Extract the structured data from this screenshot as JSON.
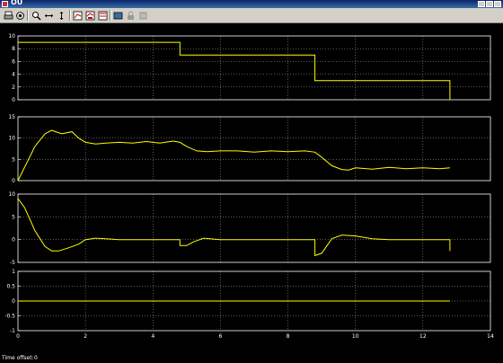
{
  "window": {
    "title": "OU"
  },
  "toolbar": {
    "buttons": [
      {
        "name": "print-icon"
      },
      {
        "name": "parameters-icon"
      },
      {
        "name": "zoom-icon"
      },
      {
        "name": "zoom-x-icon"
      },
      {
        "name": "zoom-y-icon"
      },
      {
        "name": "autoscale-icon"
      },
      {
        "name": "save-axes-icon"
      },
      {
        "name": "restore-axes-icon"
      },
      {
        "name": "floating-scope-icon"
      },
      {
        "name": "lock-axes-icon"
      },
      {
        "name": "signal-selection-icon"
      }
    ]
  },
  "status": {
    "time_offset_label": "Time offset:",
    "time_offset_value": "0"
  },
  "colors": {
    "trace": "#ffff00",
    "background": "#000000",
    "axes_bg": "#000000",
    "frame": "#ffffff",
    "grid": "#ffffff"
  },
  "chart_data": [
    {
      "type": "line",
      "title": "",
      "xlabel": "",
      "ylabel": "",
      "xlim": [
        0,
        14
      ],
      "ylim": [
        0,
        10
      ],
      "yticks": [
        "0",
        "2",
        "4",
        "6",
        "8",
        "10"
      ],
      "xticks": [],
      "grid": true,
      "series": [
        {
          "x": [
            0,
            4.8,
            4.8,
            8.8,
            8.8,
            12.8,
            12.8
          ],
          "y": [
            9,
            9,
            7,
            7,
            3,
            3,
            0
          ]
        }
      ]
    },
    {
      "type": "line",
      "title": "",
      "xlabel": "",
      "ylabel": "",
      "xlim": [
        0,
        14
      ],
      "ylim": [
        0,
        15
      ],
      "yticks": [
        "0",
        "5",
        "10",
        "15"
      ],
      "xticks": [],
      "grid": true,
      "series": [
        {
          "x": [
            0,
            0.25,
            0.5,
            0.8,
            1.0,
            1.3,
            1.6,
            1.8,
            2.0,
            2.3,
            2.6,
            3.0,
            3.4,
            3.8,
            4.2,
            4.6,
            4.8,
            5.0,
            5.3,
            5.6,
            6.0,
            6.5,
            7.0,
            7.5,
            8.0,
            8.5,
            8.8,
            9.0,
            9.3,
            9.6,
            9.8,
            10.0,
            10.5,
            11.0,
            11.5,
            12.0,
            12.5,
            12.8
          ],
          "y": [
            0,
            4,
            8,
            11,
            11.8,
            11,
            11.5,
            10,
            9,
            8.6,
            8.8,
            9,
            8.8,
            9.2,
            8.8,
            9.3,
            9,
            8,
            7,
            6.8,
            7,
            7,
            6.7,
            7,
            6.8,
            7,
            6.7,
            5.5,
            3.5,
            2.6,
            2.5,
            3,
            2.7,
            3.1,
            2.8,
            3,
            2.8,
            3
          ]
        }
      ]
    },
    {
      "type": "line",
      "title": "",
      "xlabel": "",
      "ylabel": "",
      "xlim": [
        0,
        14
      ],
      "ylim": [
        -5,
        10
      ],
      "yticks": [
        "-5",
        "0",
        "5",
        "10"
      ],
      "xticks": [],
      "grid": true,
      "series": [
        {
          "x": [
            0,
            0.2,
            0.5,
            0.8,
            1.0,
            1.2,
            1.5,
            1.8,
            2.0,
            2.3,
            2.6,
            3.0,
            4.0,
            4.8,
            4.8,
            5.0,
            5.2,
            5.5,
            6.0,
            7.0,
            8.0,
            8.8,
            8.8,
            9.0,
            9.3,
            9.6,
            10.0,
            10.5,
            11.0,
            12.0,
            12.8,
            12.8
          ],
          "y": [
            9,
            7,
            2,
            -1.5,
            -2.5,
            -2.5,
            -1.8,
            -1,
            0,
            0.3,
            0.2,
            0,
            0,
            0,
            -1.3,
            -1.3,
            -0.5,
            0.3,
            0,
            0,
            0,
            0,
            -3.5,
            -3,
            0.2,
            1,
            0.8,
            0.2,
            0,
            0,
            0,
            -2.5
          ]
        }
      ]
    },
    {
      "type": "line",
      "title": "",
      "xlabel": "",
      "ylabel": "",
      "xlim": [
        0,
        14
      ],
      "ylim": [
        -1,
        1
      ],
      "yticks": [
        "-1",
        "-0.5",
        "0",
        "0.5",
        "1"
      ],
      "xticks": [
        "0",
        "2",
        "4",
        "6",
        "8",
        "10",
        "12",
        "14"
      ],
      "grid": true,
      "series": [
        {
          "x": [
            0,
            12.8
          ],
          "y": [
            0,
            0
          ]
        }
      ]
    }
  ]
}
